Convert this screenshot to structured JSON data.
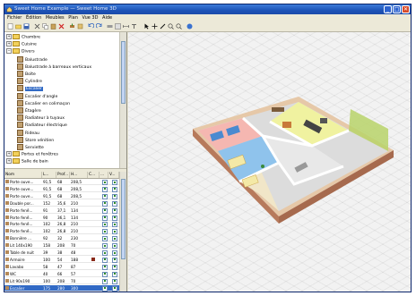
{
  "window": {
    "title": "Sweet Home Example — Sweet Home 3D",
    "controls": {
      "minimize": "_",
      "maximize": "□",
      "close": "✕"
    }
  },
  "menubar": {
    "items": [
      "Fichier",
      "Édition",
      "Meubles",
      "Plan",
      "Vue 3D",
      "Aide"
    ]
  },
  "toolbar": {
    "icons": [
      "new-icon",
      "open-icon",
      "save-icon",
      "cut-icon",
      "copy-icon",
      "paste-icon",
      "delete-icon",
      "add-furniture-icon",
      "import-icon",
      "undo-icon",
      "redo-icon",
      "wall-icon",
      "room-icon",
      "dimension-icon",
      "text-icon",
      "select-icon",
      "pan-icon",
      "create-walls-icon",
      "zoom-in-icon",
      "zoom-out-icon",
      "help-icon"
    ]
  },
  "catalog": {
    "nodes": [
      {
        "label": "Chambre",
        "level": 0,
        "type": "folder",
        "expanded": false
      },
      {
        "label": "Cuisine",
        "level": 0,
        "type": "folder",
        "expanded": false
      },
      {
        "label": "Divers",
        "level": 0,
        "type": "folder",
        "expanded": true
      },
      {
        "label": "Balustrade",
        "level": 1,
        "type": "item"
      },
      {
        "label": "Balustrade à barreaux verticaux",
        "level": 1,
        "type": "item"
      },
      {
        "label": "Boîte",
        "level": 1,
        "type": "item"
      },
      {
        "label": "Cylindre",
        "level": 1,
        "type": "item"
      },
      {
        "label": "Escalier",
        "level": 1,
        "type": "item",
        "selected": true
      },
      {
        "label": "Escalier d'angle",
        "level": 1,
        "type": "item"
      },
      {
        "label": "Escalier en colimaçon",
        "level": 1,
        "type": "item"
      },
      {
        "label": "Étagère",
        "level": 1,
        "type": "item"
      },
      {
        "label": "Radiateur à tuyaux",
        "level": 1,
        "type": "item"
      },
      {
        "label": "Radiateur électrique",
        "level": 1,
        "type": "item"
      },
      {
        "label": "Rideau",
        "level": 1,
        "type": "item"
      },
      {
        "label": "Store vénitien",
        "level": 1,
        "type": "item"
      },
      {
        "label": "Serviette",
        "level": 1,
        "type": "item"
      },
      {
        "label": "Portes et fenêtres",
        "level": 0,
        "type": "folder",
        "expanded": false
      },
      {
        "label": "Salle de bain",
        "level": 0,
        "type": "folder",
        "expanded": false
      }
    ]
  },
  "furniture_table": {
    "headers": [
      "Nom",
      "L...",
      "Prof...",
      "H...",
      "C...",
      "...",
      "V..."
    ],
    "rows": [
      {
        "name": "Porte ouve...",
        "w": "91,5",
        "d": "68",
        "h": "208,5",
        "color": "",
        "visible": true
      },
      {
        "name": "Porte ouve...",
        "w": "91,5",
        "d": "68",
        "h": "208,5",
        "color": "",
        "visible": true
      },
      {
        "name": "Porte ouve...",
        "w": "91,5",
        "d": "68",
        "h": "208,5",
        "color": "",
        "visible": true
      },
      {
        "name": "Double por...",
        "w": "152",
        "d": "35,6",
        "h": "210",
        "color": "",
        "visible": true
      },
      {
        "name": "Porte fenê...",
        "w": "91",
        "d": "37,1",
        "h": "134",
        "color": "",
        "visible": true
      },
      {
        "name": "Porte fenê...",
        "w": "90",
        "d": "36,1",
        "h": "134",
        "color": "",
        "visible": true
      },
      {
        "name": "Porte fenê...",
        "w": "102",
        "d": "26,8",
        "h": "210",
        "color": "",
        "visible": true
      },
      {
        "name": "Porte fenê...",
        "w": "102",
        "d": "26,8",
        "h": "210",
        "color": "",
        "visible": true
      },
      {
        "name": "Bonnière ...",
        "w": "92",
        "d": "32",
        "h": "230",
        "color": "",
        "visible": true
      },
      {
        "name": "Lit 140x190",
        "w": "158",
        "d": "208",
        "h": "70",
        "color": "",
        "visible": true
      },
      {
        "name": "Table de nuit",
        "w": "39",
        "d": "38",
        "h": "48",
        "color": "",
        "visible": true
      },
      {
        "name": "Armoire",
        "w": "100",
        "d": "54",
        "h": "188",
        "color": "#8a2a1a",
        "visible": true
      },
      {
        "name": "Lavabo",
        "w": "58",
        "d": "47",
        "h": "87",
        "color": "",
        "visible": true
      },
      {
        "name": "WC",
        "w": "40",
        "d": "66",
        "h": "57",
        "color": "",
        "visible": true
      },
      {
        "name": "Lit 90x190",
        "w": "100",
        "d": "208",
        "h": "70",
        "color": "",
        "visible": true
      },
      {
        "name": "Escalier",
        "w": "175",
        "d": "280",
        "h": "300",
        "color": "",
        "visible": true,
        "selected": true
      }
    ]
  },
  "colors": {
    "title_bar": "#1d53b8",
    "selection": "#316ac5",
    "wall_top": "#e6c8a8",
    "wall_side": "#b77a5c",
    "room_pink": "#f5b7b1",
    "room_yellow": "#f0f2a0",
    "room_blue": "#8fc3ec",
    "room_beige": "#f1e6c8",
    "floor_grey": "#dcdcdc"
  }
}
